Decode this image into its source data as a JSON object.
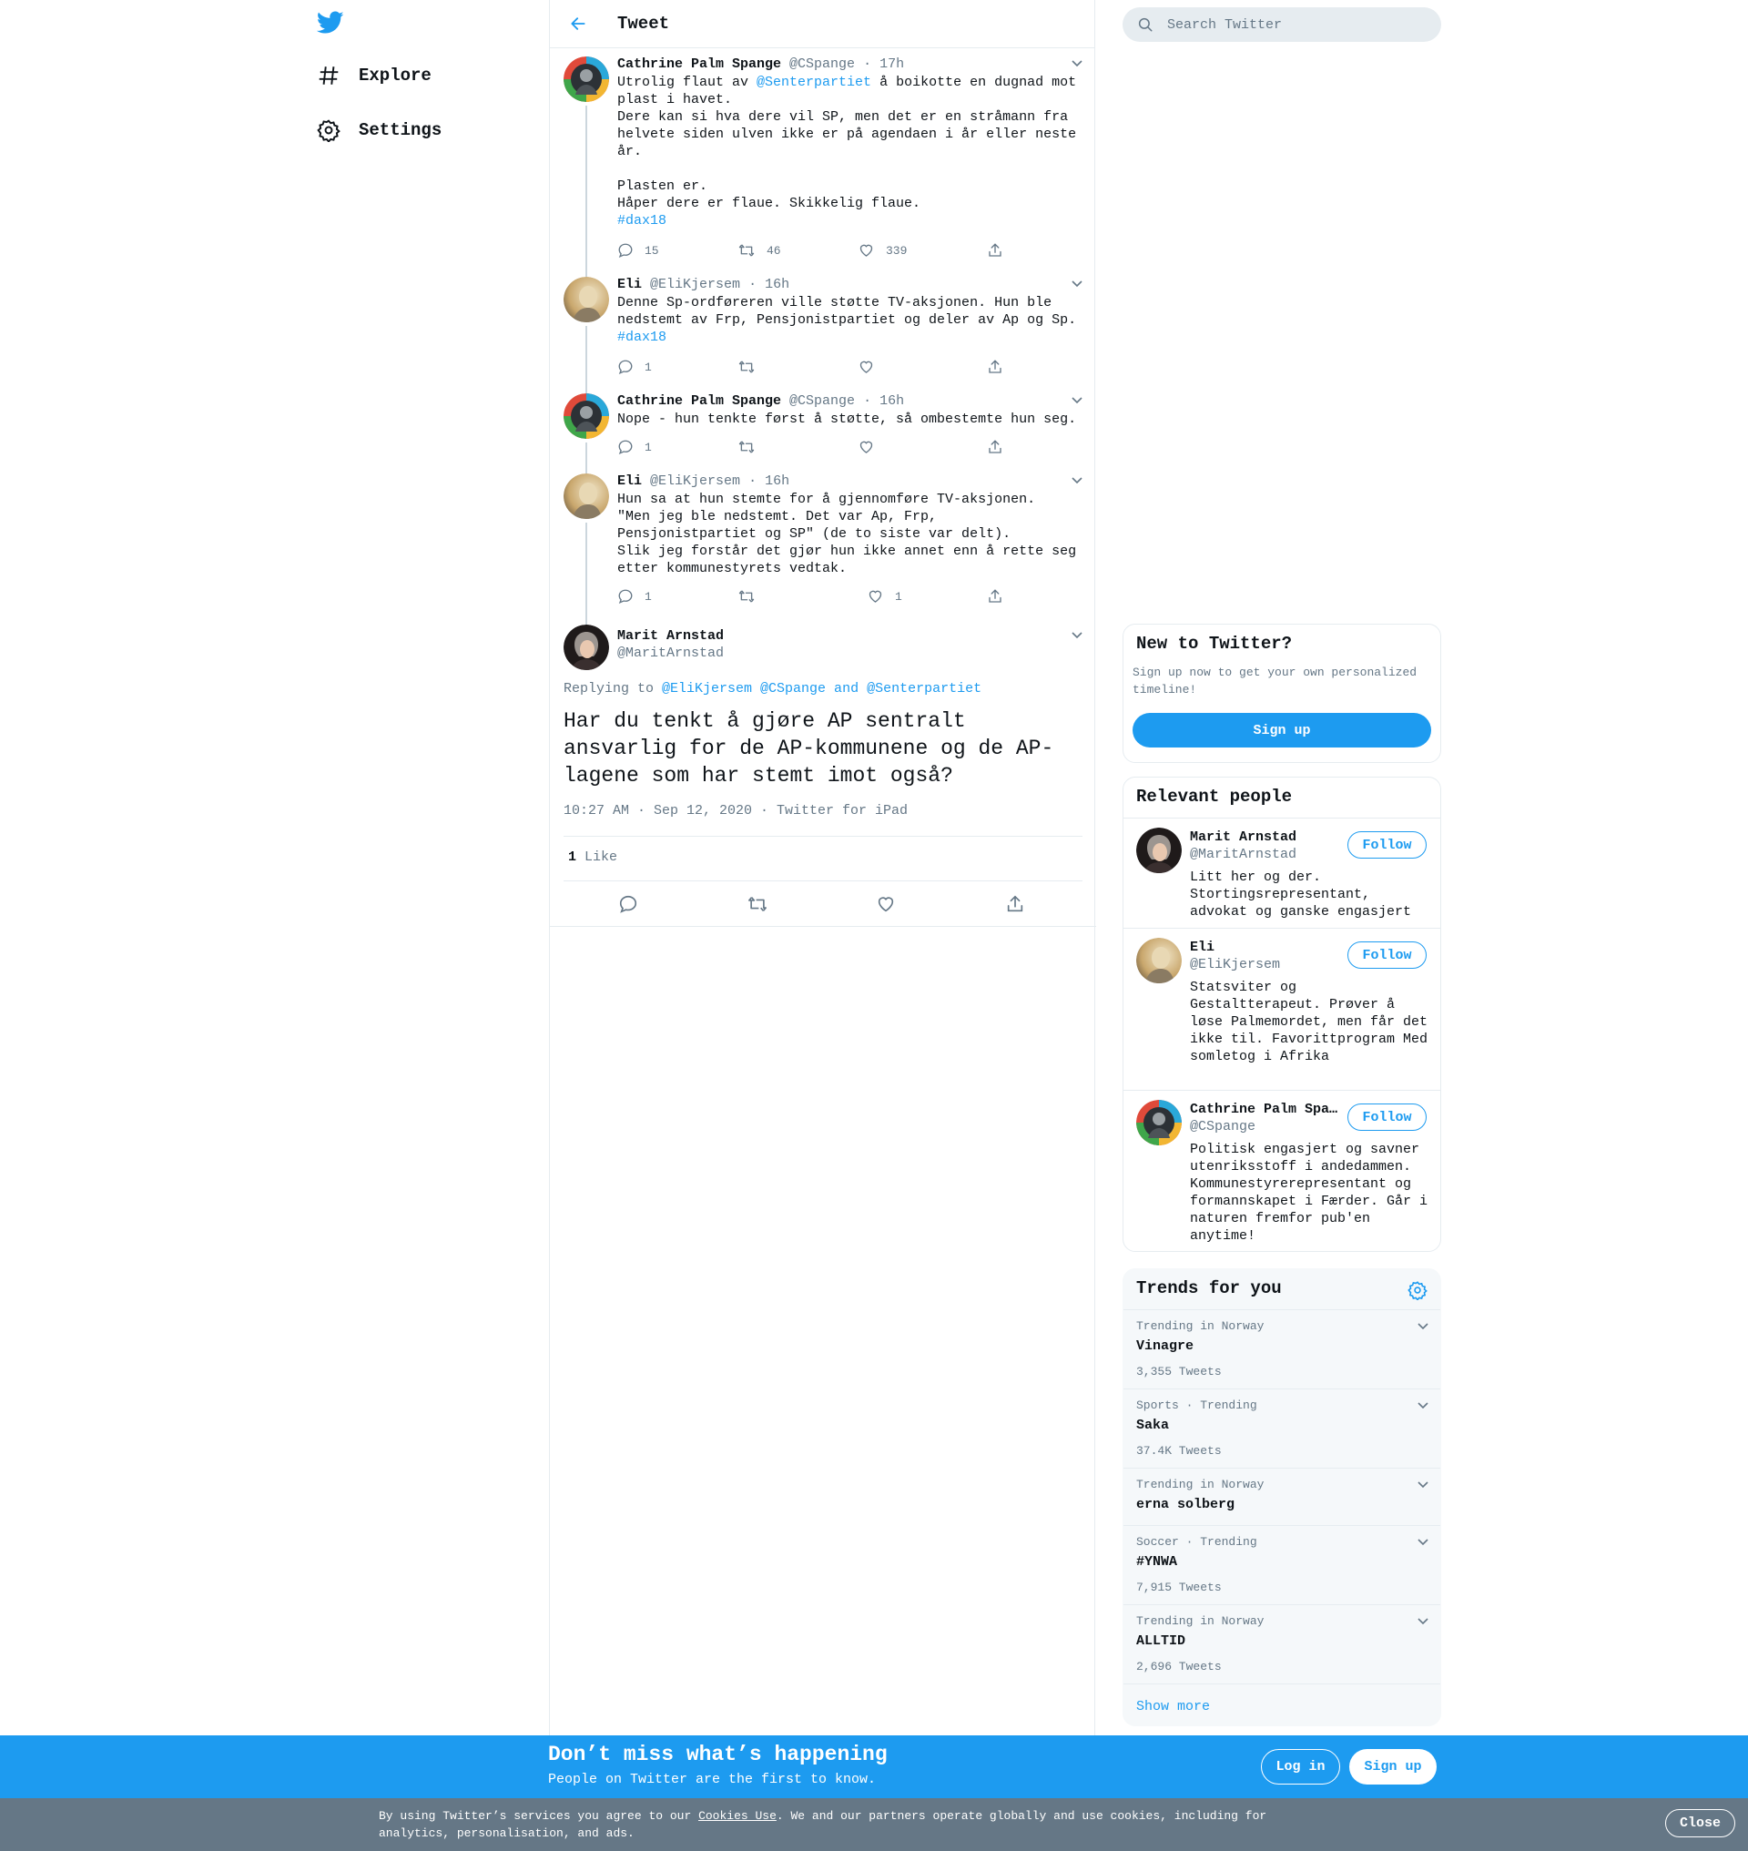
{
  "nav": {
    "logo_icon": "twitter-bird-icon",
    "items": [
      {
        "icon": "hashtag-icon",
        "label": "Explore"
      },
      {
        "icon": "gear-icon",
        "label": "Settings"
      }
    ]
  },
  "header": {
    "title": "Tweet"
  },
  "thread": [
    {
      "name": "Cathrine Palm Spange",
      "handle": "@CSpange",
      "time": "· 17h",
      "text_before": "Utrolig flaut av ",
      "mention": "@Senterpartiet",
      "text_after": " å boikotte en dugnad mot plast i havet.\nDere kan si hva dere vil SP, men det er en stråmann fra helvete siden ulven ikke er på agendaen i år eller neste år.\n\nPlasten er.\nHåper dere er flaue. Skikkelig flaue.",
      "hashtag": "#dax18",
      "replies": "15",
      "retweets": "46",
      "likes": "339"
    },
    {
      "name": "Eli",
      "handle": "@EliKjersem",
      "time": "· 16h",
      "text": "Denne Sp-ordføreren ville støtte TV-aksjonen. Hun ble nedstemt av Frp, Pensjonistpartiet og deler av Ap og Sp.",
      "hashtag": "#dax18",
      "replies": "1",
      "retweets": "",
      "likes": ""
    },
    {
      "name": "Cathrine Palm Spange",
      "handle": "@CSpange",
      "time": "· 16h",
      "text": "Nope - hun tenkte først å støtte, så ombestemte hun seg.",
      "replies": "1",
      "retweets": "",
      "likes": ""
    },
    {
      "name": "Eli",
      "handle": "@EliKjersem",
      "time": "· 16h",
      "text": "Hun sa at hun stemte for å gjennomføre TV-aksjonen.\n\"Men jeg ble nedstemt. Det var Ap, Frp, Pensjonistpartiet og SP\" (de to siste var delt).\nSlik jeg forstår det gjør hun ikke annet enn å rette seg etter kommunestyrets vedtak.",
      "replies": "1",
      "retweets": "",
      "likes": "1"
    }
  ],
  "focus": {
    "name": "Marit Arnstad",
    "handle": "@MaritArnstad",
    "replying_prefix": "Replying to ",
    "replying_to": "@EliKjersem @CSpange and @Senterpartiet",
    "text": "Har du tenkt å gjøre AP sentralt ansvarlig for de AP-kommunene og de AP-lagene  som har stemt imot også?",
    "timestamp": "10:27 AM · Sep 12, 2020 · Twitter for iPad",
    "like_count": "1",
    "like_label": "Like"
  },
  "search": {
    "placeholder": "Search Twitter"
  },
  "new_to_twitter": {
    "title": "New to Twitter?",
    "subtitle": "Sign up now to get your own personalized timeline!",
    "button": "Sign up"
  },
  "relevant_people": {
    "title": "Relevant people",
    "follow_label": "Follow",
    "people": [
      {
        "name": "Marit Arnstad",
        "handle": "@MaritArnstad",
        "bio": "Litt her og der. Stortingsrepresentant, advokat og ganske engasjert"
      },
      {
        "name": "Eli",
        "handle": "@EliKjersem",
        "bio": "Statsviter og Gestaltterapeut. Prøver å løse Palmemordet, men får det ikke til. Favorittprogram Med somletog i Afrika"
      },
      {
        "name": "Cathrine Palm Spange",
        "handle": "@CSpange",
        "bio": "Politisk engasjert og savner utenriksstoff i andedammen. Kommunestyrerepresentant og formannskapet i Færder. Går i naturen fremfor pub'en anytime!"
      }
    ]
  },
  "trends": {
    "title": "Trends for you",
    "items": [
      {
        "context": "Trending in Norway",
        "name": "Vinagre",
        "count": "3,355 Tweets"
      },
      {
        "context": "Sports · Trending",
        "name": "Saka",
        "count": "37.4K Tweets"
      },
      {
        "context": "Trending in Norway",
        "name": "erna solberg",
        "count": ""
      },
      {
        "context": "Soccer · Trending",
        "name": "#YNWA",
        "count": "7,915 Tweets"
      },
      {
        "context": "Trending in Norway",
        "name": "ALLTID",
        "count": "2,696 Tweets"
      }
    ],
    "show_more": "Show more"
  },
  "banner": {
    "title": "Don’t miss what’s happening",
    "subtitle": "People on Twitter are the first to know.",
    "login": "Log in",
    "signup": "Sign up"
  },
  "cookie": {
    "text_before": "By using Twitter’s services you agree to our ",
    "link": "Cookies Use",
    "text_after": ". We and our partners operate globally and use cookies, including for analytics, personalisation, and ads.",
    "close": "Close"
  },
  "colors": {
    "accent": "#1d9bf0",
    "muted": "#657786",
    "border": "#e6ecf0",
    "cookie_bg": "#657786"
  }
}
